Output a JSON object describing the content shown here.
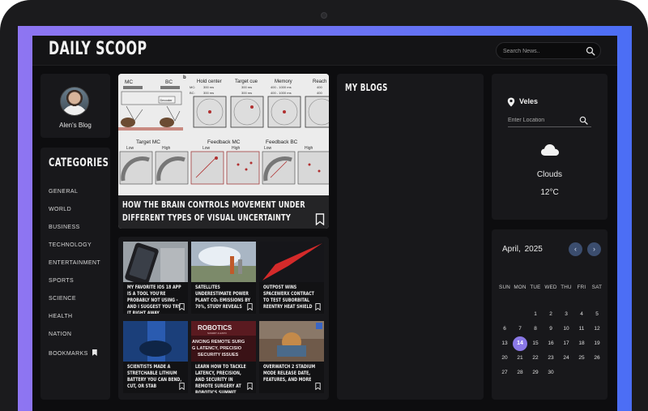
{
  "app": {
    "title": "DAILY SCOOP"
  },
  "header": {
    "search_placeholder": "Search News..",
    "search_icon": "search-icon"
  },
  "profile": {
    "name": "Alen's Blog"
  },
  "categories": {
    "title": "CATEGORIES",
    "items": [
      "GENERAL",
      "WORLD",
      "BUSINESS",
      "TECHNOLOGY",
      "ENTERTAINMENT",
      "SPORTS",
      "SCIENCE",
      "HEALTH",
      "NATION",
      "BOOKMARKS"
    ]
  },
  "hero": {
    "title": "HOW THE BRAIN CONTROLS MOVEMENT UNDER DIFFERENT TYPES OF VISUAL UNCERTAINTY",
    "figure_labels": {
      "panel_b": "b",
      "mc": "MC",
      "bc": "BC",
      "hold_center": "Hold center",
      "target_cue": "Target cue",
      "memory": "Memory",
      "reach": "Reach",
      "mc_row": "MC:",
      "bc_row": "BC:",
      "t1": "300 ms",
      "t2": "300 ms",
      "t3": "400 - 1000 ms",
      "t4": "400",
      "t5": "300 ms",
      "t6": "300 ms",
      "t7": "400 - 1000 ms",
      "t8": "400",
      "decoder": "Decoder",
      "target_mc": "Target MC",
      "feedback_mc": "Feedback MC",
      "feedback_bc": "Feedback BC",
      "low1": "Low",
      "high1": "High",
      "low2": "Low",
      "high2": "High",
      "low3": "Low",
      "high3": "High"
    }
  },
  "grid": [
    {
      "title": "MY FAVORITE IOS 18 APP IS A TOOL YOU'RE PROBABLY NOT USING - AND I SUGGEST YOU TRY IT RIGHT AWAY"
    },
    {
      "title": "SATELLITES UNDERESTIMATE POWER PLANT CO₂ EMISSIONS BY 70%, STUDY REVEALS"
    },
    {
      "title": "OUTPOST WINS SPACEWERX CONTRACT TO TEST SUBORBITAL REENTRY HEAT SHIELD"
    },
    {
      "title": "SCIENTISTS MADE A STRETCHABLE LITHIUM BATTERY YOU CAN BEND, CUT, OR STAB"
    },
    {
      "title": "LEARN HOW TO TACKLE LATENCY, PRECISION, AND SECURITY IN REMOTE SURGERY AT ROBOTICS SUMMIT",
      "img_text": {
        "brand": "ROBOTICS",
        "sub": "SUMMIT & EXPO",
        "l1": "ANCING REMOTE SURG",
        "l2": "G LATENCY, PRECISIO",
        "l3": "SECURITY ISSUES"
      }
    },
    {
      "title": "OVERWATCH 2 STADIUM MODE RELEASE DATE, FEATURES, AND MORE"
    }
  ],
  "blogs": {
    "title": "MY BLOGS"
  },
  "weather": {
    "city": "Veles",
    "location_placeholder": "Enter Location",
    "condition": "Clouds",
    "temperature": "12°C"
  },
  "calendar": {
    "month": "April,",
    "year": "2025",
    "prev": "‹",
    "next": "›",
    "weekdays": [
      "SUN",
      "MON",
      "TUE",
      "WED",
      "THU",
      "FRI",
      "SAT"
    ],
    "days": [
      "1",
      "2",
      "3",
      "4",
      "5",
      "6",
      "7",
      "8",
      "9",
      "10",
      "11",
      "12",
      "13",
      "14",
      "15",
      "16",
      "17",
      "18",
      "19",
      "20",
      "21",
      "22",
      "23",
      "24",
      "25",
      "26",
      "27",
      "28",
      "29",
      "30"
    ],
    "today": "14",
    "first_weekday": 2,
    "accent": "#8a78e6"
  },
  "colors": {
    "background": "#0d0d0f",
    "panel": "#18181b",
    "glow": "#7a74f3"
  }
}
